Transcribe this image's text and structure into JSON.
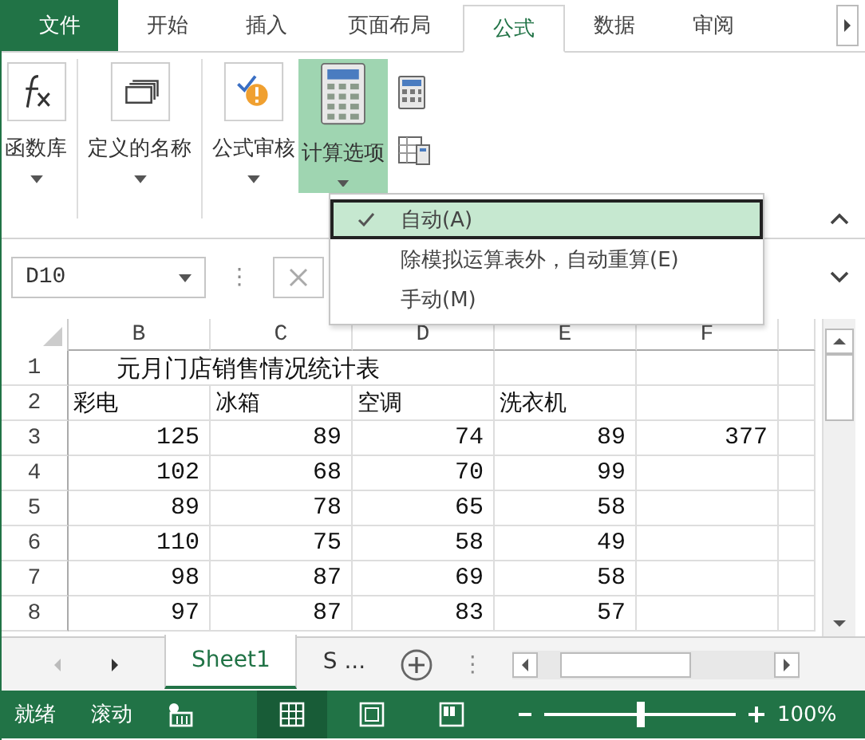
{
  "tabs": [
    {
      "label": "文件",
      "kind": "file",
      "selected": false
    },
    {
      "label": "开始",
      "kind": "tab",
      "selected": false
    },
    {
      "label": "插入",
      "kind": "tab",
      "selected": false
    },
    {
      "label": "页面布局",
      "kind": "tab",
      "selected": false
    },
    {
      "label": "公式",
      "kind": "tab",
      "selected": true
    },
    {
      "label": "数据",
      "kind": "tab",
      "selected": false
    },
    {
      "label": "审阅",
      "kind": "tab",
      "selected": false
    }
  ],
  "ribbon": {
    "groups": [
      {
        "label": "函数库",
        "selected": false
      },
      {
        "label": "定义的名称",
        "selected": false
      },
      {
        "label": "公式审核",
        "selected": false
      },
      {
        "label": "计算选项",
        "selected": true
      }
    ]
  },
  "calc_menu": {
    "items": [
      {
        "label": "自动(A)",
        "checked": true,
        "selected": true
      },
      {
        "label": "除模拟运算表外，自动重算(E)",
        "checked": false,
        "selected": false
      },
      {
        "label": "手动(M)",
        "checked": false,
        "selected": false
      }
    ]
  },
  "formula_bar": {
    "name_box": "D10",
    "separator": "⋮"
  },
  "sheet": {
    "columns": [
      "B",
      "C",
      "D",
      "E",
      "F"
    ],
    "title": "元月门店销售情况统计表",
    "rows": [
      {
        "num": "1",
        "cells": []
      },
      {
        "num": "2",
        "cells": [
          "彩电",
          "冰箱",
          "空调",
          "洗衣机"
        ]
      },
      {
        "num": "3",
        "cells": [
          "125",
          "89",
          "74",
          "89",
          "377"
        ]
      },
      {
        "num": "4",
        "cells": [
          "102",
          "68",
          "70",
          "99"
        ]
      },
      {
        "num": "5",
        "cells": [
          "89",
          "78",
          "65",
          "58"
        ]
      },
      {
        "num": "6",
        "cells": [
          "110",
          "75",
          "58",
          "49"
        ]
      },
      {
        "num": "7",
        "cells": [
          "98",
          "87",
          "69",
          "58"
        ]
      },
      {
        "num": "8",
        "cells": [
          "97",
          "87",
          "83",
          "57"
        ]
      }
    ]
  },
  "sheet_tabs": {
    "tabs": [
      {
        "label": "Sheet1",
        "selected": true
      },
      {
        "label": "S ...",
        "selected": false
      }
    ],
    "separator": "⋮"
  },
  "status_bar": {
    "items": [
      "就绪",
      "滚动"
    ],
    "views": [
      {
        "selected": true
      },
      {
        "selected": false
      },
      {
        "selected": false
      }
    ],
    "zoom": {
      "level": 0.5,
      "reading": "100%"
    }
  }
}
